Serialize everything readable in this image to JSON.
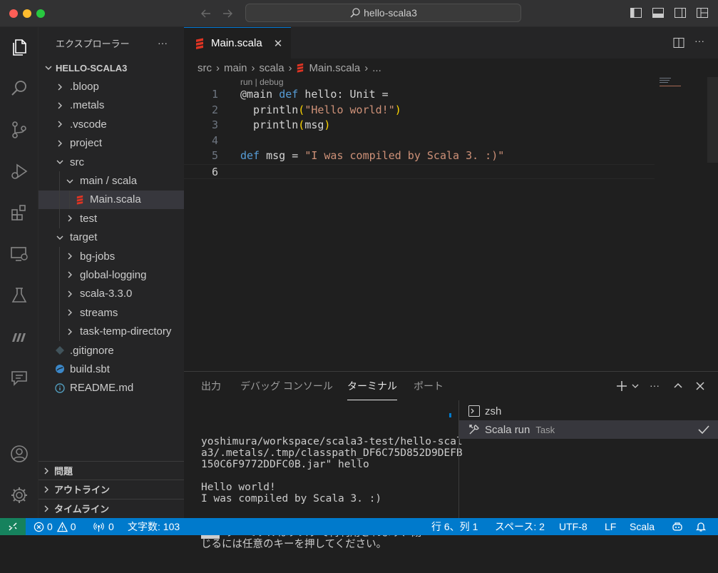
{
  "window": {
    "title": "hello-scala3"
  },
  "sidebar": {
    "title": "エクスプローラー",
    "more": "···",
    "root": "HELLO-SCALA3",
    "items": [
      {
        "label": ".bloop",
        "type": "folder",
        "indent": 1,
        "open": false
      },
      {
        "label": ".metals",
        "type": "folder",
        "indent": 1,
        "open": false
      },
      {
        "label": ".vscode",
        "type": "folder",
        "indent": 1,
        "open": false
      },
      {
        "label": "project",
        "type": "folder",
        "indent": 1,
        "open": false
      },
      {
        "label": "src",
        "type": "folder",
        "indent": 1,
        "open": true
      },
      {
        "label": "main / scala",
        "type": "folder",
        "indent": 2,
        "open": true
      },
      {
        "label": "Main.scala",
        "type": "scala-file",
        "indent": 3,
        "selected": true
      },
      {
        "label": "test",
        "type": "folder",
        "indent": 2,
        "open": false
      },
      {
        "label": "target",
        "type": "folder",
        "indent": 1,
        "open": true
      },
      {
        "label": "bg-jobs",
        "type": "folder",
        "indent": 2,
        "open": false
      },
      {
        "label": "global-logging",
        "type": "folder",
        "indent": 2,
        "open": false
      },
      {
        "label": "scala-3.3.0",
        "type": "folder",
        "indent": 2,
        "open": false
      },
      {
        "label": "streams",
        "type": "folder",
        "indent": 2,
        "open": false
      },
      {
        "label": "task-temp-directory",
        "type": "folder",
        "indent": 2,
        "open": false
      },
      {
        "label": ".gitignore",
        "type": "git-file",
        "indent": 1
      },
      {
        "label": "build.sbt",
        "type": "sbt-file",
        "indent": 1
      },
      {
        "label": "README.md",
        "type": "info-file",
        "indent": 1
      }
    ],
    "sections": {
      "problems": "問題",
      "outline": "アウトライン",
      "timeline": "タイムライン"
    }
  },
  "editor": {
    "tab": {
      "label": "Main.scala",
      "close": "✕"
    },
    "breadcrumbs": [
      "src",
      "main",
      "scala",
      "Main.scala",
      "..."
    ],
    "codelens": "run | debug",
    "lines": [
      {
        "n": "1",
        "tokens": [
          {
            "t": "@",
            "c": "dec"
          },
          {
            "t": "main ",
            "c": "t"
          },
          {
            "t": "def ",
            "c": "k"
          },
          {
            "t": "hello",
            "c": "t"
          },
          {
            "t": ": ",
            "c": "t"
          },
          {
            "t": "Unit",
            "c": "t"
          },
          {
            "t": " =",
            "c": "t"
          }
        ]
      },
      {
        "n": "2",
        "tokens": [
          {
            "t": "  println",
            "c": "t"
          },
          {
            "t": "(",
            "c": "p"
          },
          {
            "t": "\"Hello world!\"",
            "c": "s"
          },
          {
            "t": ")",
            "c": "p"
          }
        ]
      },
      {
        "n": "3",
        "tokens": [
          {
            "t": "  println",
            "c": "t"
          },
          {
            "t": "(",
            "c": "p"
          },
          {
            "t": "msg",
            "c": "t"
          },
          {
            "t": ")",
            "c": "p"
          }
        ]
      },
      {
        "n": "4",
        "tokens": []
      },
      {
        "n": "5",
        "tokens": [
          {
            "t": "def ",
            "c": "k"
          },
          {
            "t": "msg = ",
            "c": "t"
          },
          {
            "t": "\"I was compiled by Scala 3. :)\"",
            "c": "s"
          }
        ]
      },
      {
        "n": "6",
        "tokens": []
      }
    ],
    "current_line": "6"
  },
  "panel": {
    "tabs": [
      "出力",
      "デバッグ コンソール",
      "ターミナル",
      "ポート"
    ],
    "active_tab": "ターミナル",
    "terminal_output": "yoshimura/workspace/scala3-test/hello-scal\na3/.metals/.tmp/classpath_DF6C75D852D9DEFB\n150C6F9772DDFC0B.jar\" hello\n\nHello world!\nI was compiled by Scala 3. :)",
    "terminal_notice_marker": " * ",
    "terminal_notice": " ターミナルはタスクで再利用されます、閉\nじるには任意のキーを押してください。",
    "terminals": [
      {
        "name": "zsh",
        "sub": "",
        "icon": "terminal-icon"
      },
      {
        "name": "Scala run",
        "sub": "Task",
        "icon": "tools-icon",
        "active": true
      }
    ]
  },
  "statusbar": {
    "errors": "0",
    "warnings": "0",
    "ports": "0",
    "chars": "文字数: 103",
    "position": "行 6、列 1",
    "spaces": "スペース: 2",
    "encoding": "UTF-8",
    "eol": "LF",
    "language": "Scala"
  }
}
